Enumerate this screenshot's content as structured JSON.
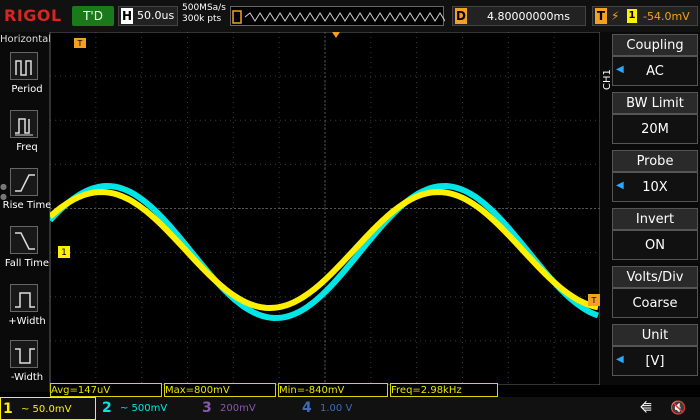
{
  "brand": {
    "logo": "RIGOL",
    "run_state": "T'D"
  },
  "timebase": {
    "label": "H",
    "value": "50.0us"
  },
  "sample": {
    "rate": "500MSa/s",
    "depth": "300k pts"
  },
  "delay": {
    "label": "D",
    "value": "4.80000000ms"
  },
  "trigger": {
    "label": "T",
    "source": "1",
    "level": "-54.0mV"
  },
  "left_menu": {
    "title": "Horizontal",
    "items": [
      {
        "label": "Period"
      },
      {
        "label": "Freq"
      },
      {
        "label": "Rise Time"
      },
      {
        "label": "Fall Time"
      },
      {
        "label": "+Width"
      },
      {
        "label": "-Width"
      }
    ]
  },
  "right_menu": {
    "channel": "CH1",
    "items": [
      {
        "header": "Coupling",
        "value": "AC"
      },
      {
        "header": "BW Limit",
        "value": "20M"
      },
      {
        "header": "Probe",
        "value": "10X"
      },
      {
        "header": "Invert",
        "value": "ON"
      },
      {
        "header": "Volts/Div",
        "value": "Coarse"
      },
      {
        "header": "Unit",
        "value": "[V]"
      }
    ]
  },
  "measurements": {
    "avg": "Avg=147uV",
    "max": "Max=800mV",
    "min": "Min=-840mV",
    "freq": "Freq=2.98kHz"
  },
  "channels": [
    {
      "num": "1",
      "value": "~ 50.0mV",
      "color": "#ffef00"
    },
    {
      "num": "2",
      "value": "~ 500mV",
      "color": "#00e6e6"
    },
    {
      "num": "3",
      "value": "200mV",
      "color": "#8a56b0"
    },
    {
      "num": "4",
      "value": "1.00 V",
      "color": "#3b6dbb"
    }
  ],
  "markers": {
    "trigger_pos": "T",
    "ch1_ground": "1"
  },
  "icons": {
    "usb": "usb-icon",
    "sound": "speaker-mute-icon"
  }
}
